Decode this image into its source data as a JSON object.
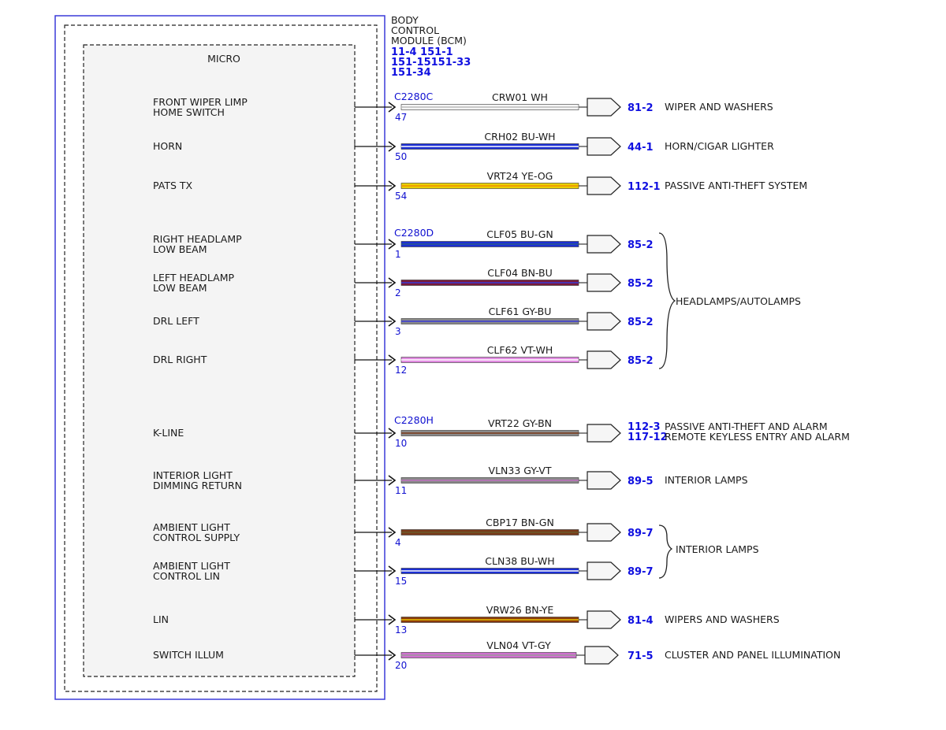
{
  "module": {
    "title_lines": [
      "BODY",
      "CONTROL",
      "MODULE (BCM)"
    ],
    "refs": [
      "11-4  151-1",
      "151-15151-33",
      "151-34"
    ],
    "micro_label": "MICRO"
  },
  "colors": {
    "border_blue": "#3a3ad8",
    "ref_blue": "#1010e0",
    "WH": "#d8d8d8",
    "BU": "#1c2fd4",
    "YE": "#e8d000",
    "OG": "#f08a00",
    "GN": "#2a9a2a",
    "BN": "#7a3a1a",
    "GY": "#8a8a8a",
    "VT": "#d070d0",
    "BN_BU": "#7a1a3a",
    "GY_VT": "#9a7a9a"
  },
  "circuits": [
    {
      "id": "front-wiper-limp",
      "label": [
        "FRONT WIPER LIMP",
        "HOME SWITCH"
      ],
      "connector": "C2280C",
      "pin": "47",
      "wire": "CRW01 WH",
      "fill": "#f4f4f4",
      "stripe": "#bdbdbd",
      "ref": "81-2",
      "dest": [
        "WIPER AND WASHERS"
      ]
    },
    {
      "id": "horn",
      "label": [
        "HORN"
      ],
      "connector": "",
      "pin": "50",
      "wire": "CRH02  BU-WH",
      "fill": "#1c2fd4",
      "stripe": "#ffffff",
      "ref": "44-1",
      "dest": [
        "HORN/CIGAR LIGHTER"
      ]
    },
    {
      "id": "pats-tx",
      "label": [
        "PATS TX"
      ],
      "connector": "",
      "pin": "54",
      "wire": "VRT24  YE-OG",
      "fill": "#e8d000",
      "stripe": "#f09000",
      "ref": "112-1",
      "dest": [
        "PASSIVE ANTI-THEFT SYSTEM"
      ]
    },
    {
      "id": "right-headlamp",
      "label": [
        "RIGHT HEADLAMP",
        "LOW BEAM"
      ],
      "connector": "C2280D",
      "pin": "1",
      "wire": "CLF05  BU-GN",
      "fill": "#1c2fd4",
      "stripe": "#2a5a8a",
      "ref": "85-2",
      "dest": []
    },
    {
      "id": "left-headlamp",
      "label": [
        "LEFT HEADLAMP",
        "LOW BEAM"
      ],
      "connector": "",
      "pin": "2",
      "wire": "CLF04  BN-BU",
      "fill": "#7a1a3a",
      "stripe": "#3a3ad8",
      "ref": "85-2",
      "dest": []
    },
    {
      "id": "drl-left",
      "label": [
        "DRL LEFT"
      ],
      "connector": "",
      "pin": "3",
      "wire": "CLF61  GY-BU",
      "fill": "#8a8a8a",
      "stripe": "#3a3ad8",
      "ref": "85-2",
      "dest": []
    },
    {
      "id": "drl-right",
      "label": [
        "DRL RIGHT"
      ],
      "connector": "",
      "pin": "12",
      "wire": "CLF62  VT-WH",
      "fill": "#e08ae0",
      "stripe": "#ffffff",
      "ref": "85-2",
      "dest": []
    },
    {
      "id": "k-line",
      "label": [
        "K-LINE"
      ],
      "connector": "C2280H",
      "pin": "10",
      "wire": "VRT22  GY-BN",
      "fill": "#8a8a8a",
      "stripe": "#7a3a1a",
      "ref": "112-3",
      "ref2": "117-12",
      "dest": [
        "PASSIVE ANTI-THEFT AND ALARM",
        "REMOTE KEYLESS ENTRY AND ALARM"
      ]
    },
    {
      "id": "interior-dimming",
      "label": [
        "INTERIOR LIGHT",
        "DIMMING RETURN"
      ],
      "connector": "",
      "pin": "11",
      "wire": "VLN33  GY-VT",
      "fill": "#8a8a8a",
      "stripe": "#c070c0",
      "ref": "89-5",
      "dest": [
        "INTERIOR LAMPS"
      ]
    },
    {
      "id": "ambient-supply",
      "label": [
        "AMBIENT LIGHT",
        "CONTROL SUPPLY"
      ],
      "connector": "",
      "pin": "4",
      "wire": "CBP17  BN-GN",
      "fill": "#7a3a1a",
      "stripe": "#6a5a2a",
      "ref": "89-7",
      "dest": []
    },
    {
      "id": "ambient-lin",
      "label": [
        "AMBIENT LIGHT",
        "CONTROL LIN"
      ],
      "connector": "",
      "pin": "15",
      "wire": "CLN38  BU-WH",
      "fill": "#1c2fd4",
      "stripe": "#ffffff",
      "ref": "89-7",
      "dest": []
    },
    {
      "id": "lin",
      "label": [
        "LIN"
      ],
      "connector": "",
      "pin": "13",
      "wire": "VRW26  BN-YE",
      "fill": "#8a3a0a",
      "stripe": "#e8c000",
      "ref": "81-4",
      "dest": [
        "WIPERS AND WASHERS"
      ]
    },
    {
      "id": "switch-illum",
      "label": [
        "SWITCH ILLUM"
      ],
      "connector": "",
      "pin": "20",
      "wire": "VLN04  VT-GY",
      "fill": "#d070d0",
      "stripe": "#9a9a9a",
      "ref": "71-5",
      "dest": [
        "CLUSTER AND PANEL ILLUMINATION"
      ]
    }
  ],
  "groups": [
    {
      "id": "headlamps",
      "label": "HEADLAMPS/AUTOLAMPS"
    },
    {
      "id": "interior",
      "label": "INTERIOR LAMPS"
    }
  ]
}
